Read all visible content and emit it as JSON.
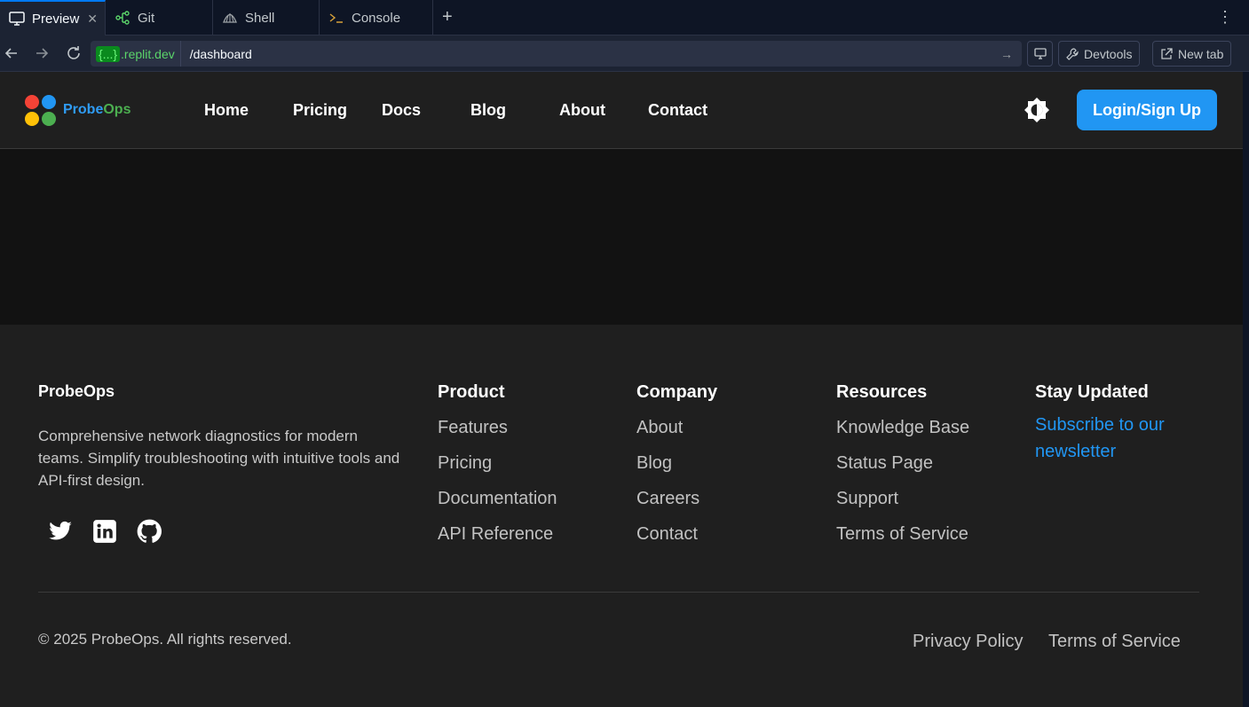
{
  "workspace": {
    "tabs": [
      {
        "label": "Preview",
        "icon": "monitor-icon",
        "active": true
      },
      {
        "label": "Git",
        "icon": "git-branch-icon"
      },
      {
        "label": "Shell",
        "icon": "shell-icon"
      },
      {
        "label": "Console",
        "icon": "terminal-icon"
      }
    ],
    "new_tab": "+",
    "more": "⋮"
  },
  "address_bar": {
    "host_tag": "{...}",
    "host": ".replit.dev",
    "path": "/dashboard",
    "devtools": "Devtools",
    "new_tab": "New tab"
  },
  "header": {
    "brand_part1": "Probe",
    "brand_part2": "Ops",
    "nav": [
      "Home",
      "Pricing",
      "Docs",
      "Blog",
      "About",
      "Contact"
    ],
    "login": "Login/Sign Up"
  },
  "footer": {
    "brand": "ProbeOps",
    "description": "Comprehensive network diagnostics for modern teams. Simplify troubleshooting with intuitive tools and API-first design.",
    "social": [
      "twitter-icon",
      "linkedin-icon",
      "github-icon"
    ],
    "columns": [
      {
        "title": "Product",
        "links": [
          "Features",
          "Pricing",
          "Documentation",
          "API Reference"
        ]
      },
      {
        "title": "Company",
        "links": [
          "About",
          "Blog",
          "Careers",
          "Contact"
        ]
      },
      {
        "title": "Resources",
        "links": [
          "Knowledge Base",
          "Status Page",
          "Support",
          "Terms of Service"
        ]
      }
    ],
    "stay_updated": {
      "title": "Stay Updated",
      "link": "Subscribe to our newsletter"
    },
    "copyright": "© 2025 ProbeOps. All rights reserved.",
    "legal": [
      "Privacy Policy",
      "Terms of Service"
    ]
  },
  "colors": {
    "accent": "#2196f3",
    "brand_green": "#4caf50",
    "logo_red": "#f44336",
    "logo_blue": "#2196f3",
    "logo_yellow": "#ffc107",
    "logo_green": "#4caf50"
  }
}
